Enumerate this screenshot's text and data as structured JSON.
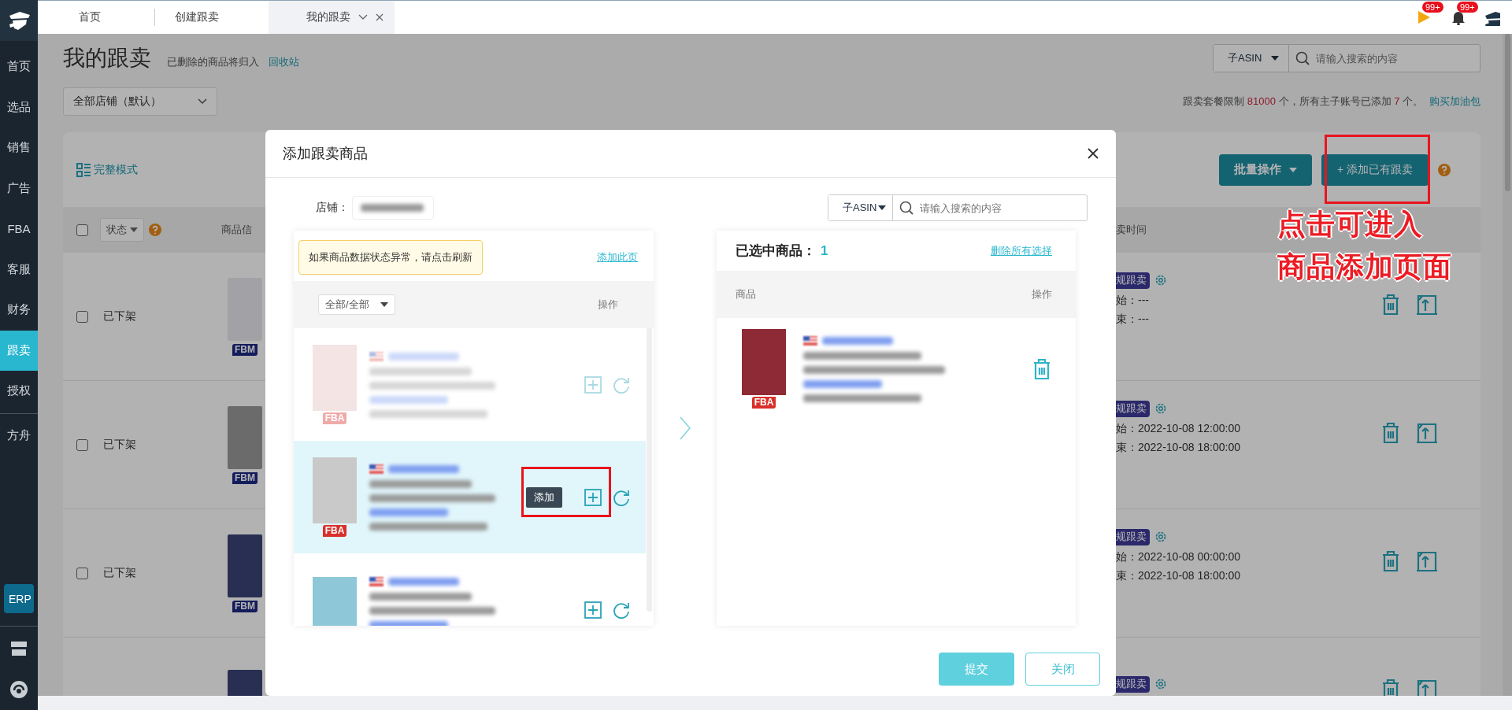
{
  "sidebar": {
    "items": [
      {
        "label": "首页",
        "selected": false
      },
      {
        "label": "选品",
        "selected": false
      },
      {
        "label": "销售",
        "selected": false
      },
      {
        "label": "广告",
        "selected": false
      },
      {
        "label": "FBA",
        "selected": false
      },
      {
        "label": "客服",
        "selected": false
      },
      {
        "label": "财务",
        "selected": false
      },
      {
        "label": "跟卖",
        "selected": true
      },
      {
        "label": "授权",
        "selected": false
      },
      {
        "label": "方舟",
        "selected": false,
        "divider_before": true
      }
    ],
    "erp_button": "ERP"
  },
  "tabs": [
    {
      "label": "首页",
      "selected": false,
      "closable": false
    },
    {
      "label": "创建跟卖",
      "selected": false,
      "closable": false
    },
    {
      "label": "我的跟卖",
      "selected": true,
      "closable": true
    }
  ],
  "header_icons": {
    "flag_badge": "99+",
    "bell_badge": "99+"
  },
  "page": {
    "title": "我的跟卖",
    "subtitle": "已删除的商品将归入",
    "recycle_link": "回收站",
    "store_select": "全部店铺（默认）",
    "search": {
      "type": "子ASIN",
      "placeholder": "请输入搜索的内容"
    },
    "quota": "跟卖套餐限制 **81000** 个，所有主子账号已添加 **7** 个。",
    "quota_link": "购买加油包"
  },
  "toolbar": {
    "mode_link": "完整模式",
    "batch_button": "批量操作",
    "add_button": "+ 添加已有跟卖"
  },
  "table": {
    "select_all_checked": false,
    "status_filter": "状态",
    "columns": [
      "商品信",
      "卖时间"
    ],
    "rows": [
      {
        "checked": false,
        "status": "已下架",
        "fulfillment": "FBM",
        "type": "规跟卖",
        "start": "始：---",
        "end": "束：---"
      },
      {
        "checked": false,
        "status": "已下架",
        "fulfillment": "FBM",
        "type": "规跟卖",
        "start": "始：2022-10-08 12:00:00",
        "end": "束：2022-10-08 18:00:00"
      },
      {
        "checked": false,
        "status": "已下架",
        "fulfillment": "FBM",
        "type": "规跟卖",
        "start": "始：2022-10-08 00:00:00",
        "end": "束：2022-10-08 18:00:00"
      },
      {
        "type": "规跟卖"
      }
    ]
  },
  "modal": {
    "title": "添加跟卖商品",
    "store_label": "店铺：",
    "search": {
      "type": "子ASIN",
      "placeholder": "请输入搜索的内容"
    },
    "notice": "如果商品数据状态异常，请点击刷新",
    "add_page_link": "添加此页",
    "filter_select": "全部/全部",
    "action_header": "操作",
    "products": [
      {
        "fulfillment": "FBA",
        "added": true,
        "highlighted": false
      },
      {
        "fulfillment": "FBA",
        "added": false,
        "highlighted": true,
        "tooltip": "添加"
      },
      {
        "added": false,
        "highlighted": false
      }
    ],
    "selected_title": "已选中商品：",
    "selected_count": "1",
    "clear_link": "删除所有选择",
    "selected_columns": [
      "商品",
      "操作"
    ],
    "selected_products": [
      {
        "fulfillment": "FBA"
      }
    ],
    "submit_button": "提交",
    "close_button": "关闭"
  },
  "callout": {
    "lines": [
      "点击可进入",
      "商品添加页面"
    ]
  }
}
